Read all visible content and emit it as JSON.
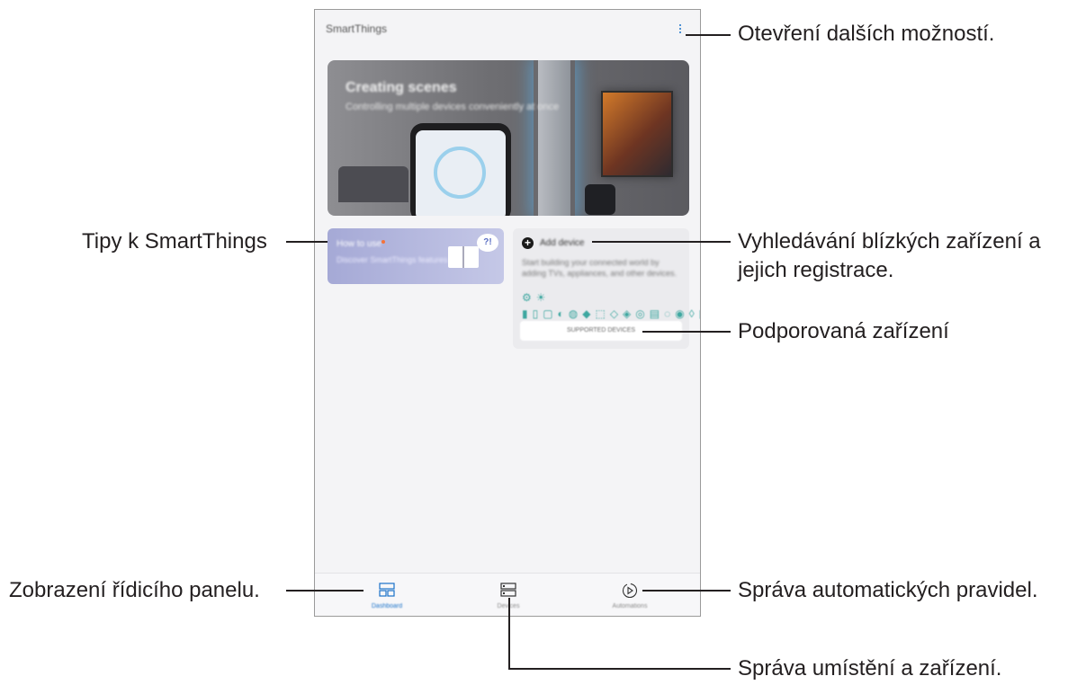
{
  "app": {
    "title": "SmartThings"
  },
  "banner": {
    "title": "Creating scenes",
    "subtitle": "Controlling multiple devices conveniently at once"
  },
  "tips_card": {
    "title": "How to use",
    "subtitle": "Discover SmartThings features",
    "badge": "?!"
  },
  "add_device_card": {
    "title": "Add device",
    "description": "Start building your connected world by adding TVs, appliances, and other devices.",
    "icons": "⚙☀▮▯▢◐◍◆⬚◇◈◎▤◌◉◊▣",
    "supported_button": "SUPPORTED DEVICES"
  },
  "navbar": {
    "items": [
      {
        "label": "Dashboard",
        "icon": "dashboard-icon"
      },
      {
        "label": "Devices",
        "icon": "devices-icon"
      },
      {
        "label": "Automations",
        "icon": "automations-icon"
      }
    ]
  },
  "callouts": {
    "more_options": "Otevření dalších možností.",
    "tips": "Tipy k SmartThings",
    "search_line1": "Vyhledávání blízkých zařízení a",
    "search_line2": "jejich registrace.",
    "supported": "Podporovaná zařízení",
    "dashboard": "Zobrazení řídicího panelu.",
    "automation": "Správa automatických pravidel.",
    "locations": "Správa umístění a zařízení."
  },
  "colors": {
    "accent_blue": "#1a72c9",
    "icon_teal": "#3ea7a0",
    "tips_purple": "#a5a9d6"
  }
}
